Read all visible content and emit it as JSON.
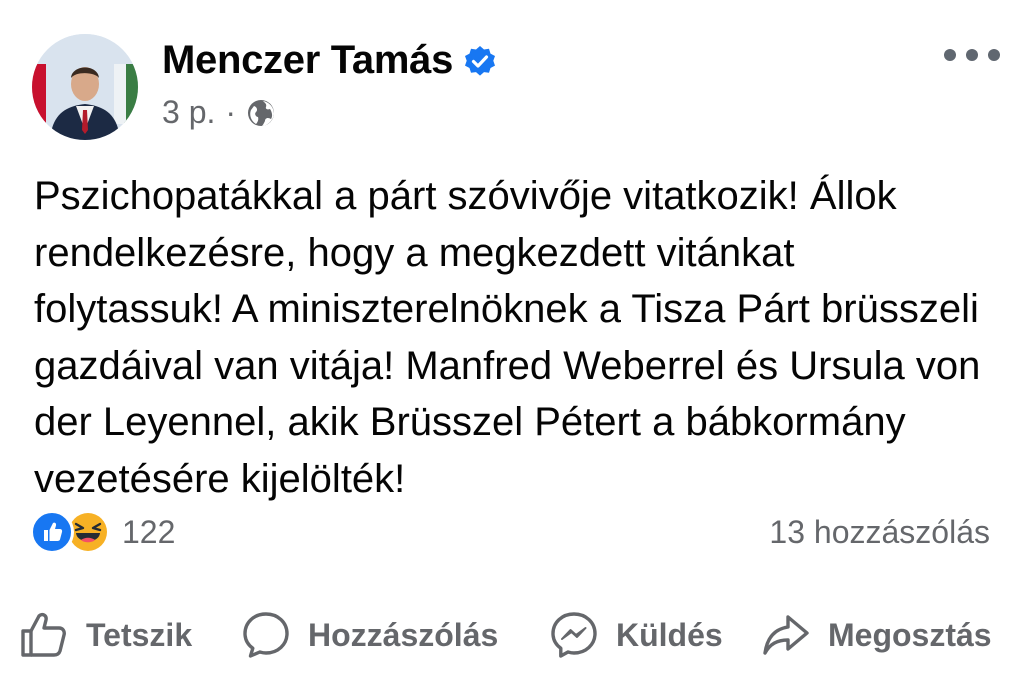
{
  "post": {
    "author": "Menczer Tamás",
    "verified": true,
    "time": "3 p.",
    "separator": "·",
    "audience_icon": "globe-icon",
    "text": "Pszichopatákkal a párt szóvivője vitatkozik! Állok rendelkezésre, hogy a megkezdett vitánkat folytassuk! A miniszterelnöknek a Tisza Párt brüsszeli gazdáival van vitája! Manfred Weberrel és Ursula von der Leyennel, akik Brüsszel Pétert a bábkormány vezetésére kijelölték!",
    "reactions": {
      "icons": [
        "like-reaction-icon",
        "haha-reaction-icon"
      ],
      "count": "122"
    },
    "comments_count": "13 hozzászólás"
  },
  "actions": [
    {
      "label": "Tetszik",
      "icon": "thumbs-up-icon"
    },
    {
      "label": "Hozzászólás",
      "icon": "comment-bubble-icon"
    },
    {
      "label": "Küldés",
      "icon": "messenger-icon"
    },
    {
      "label": "Megosztás",
      "icon": "share-arrow-icon"
    }
  ],
  "colors": {
    "text": "#050505",
    "secondary": "#65676b",
    "brand_blue": "#1877f2",
    "haha_yellow": "#f7b125"
  }
}
